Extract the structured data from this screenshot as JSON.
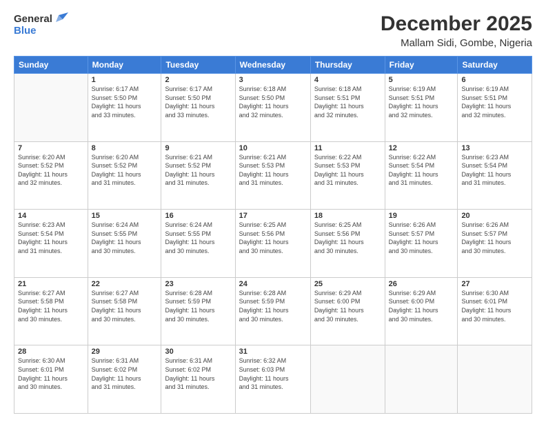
{
  "header": {
    "logo_general": "General",
    "logo_blue": "Blue",
    "month": "December 2025",
    "location": "Mallam Sidi, Gombe, Nigeria"
  },
  "days_of_week": [
    "Sunday",
    "Monday",
    "Tuesday",
    "Wednesday",
    "Thursday",
    "Friday",
    "Saturday"
  ],
  "weeks": [
    [
      {
        "day": "",
        "info": ""
      },
      {
        "day": "1",
        "info": "Sunrise: 6:17 AM\nSunset: 5:50 PM\nDaylight: 11 hours\nand 33 minutes."
      },
      {
        "day": "2",
        "info": "Sunrise: 6:17 AM\nSunset: 5:50 PM\nDaylight: 11 hours\nand 33 minutes."
      },
      {
        "day": "3",
        "info": "Sunrise: 6:18 AM\nSunset: 5:50 PM\nDaylight: 11 hours\nand 32 minutes."
      },
      {
        "day": "4",
        "info": "Sunrise: 6:18 AM\nSunset: 5:51 PM\nDaylight: 11 hours\nand 32 minutes."
      },
      {
        "day": "5",
        "info": "Sunrise: 6:19 AM\nSunset: 5:51 PM\nDaylight: 11 hours\nand 32 minutes."
      },
      {
        "day": "6",
        "info": "Sunrise: 6:19 AM\nSunset: 5:51 PM\nDaylight: 11 hours\nand 32 minutes."
      }
    ],
    [
      {
        "day": "7",
        "info": "Sunrise: 6:20 AM\nSunset: 5:52 PM\nDaylight: 11 hours\nand 32 minutes."
      },
      {
        "day": "8",
        "info": "Sunrise: 6:20 AM\nSunset: 5:52 PM\nDaylight: 11 hours\nand 31 minutes."
      },
      {
        "day": "9",
        "info": "Sunrise: 6:21 AM\nSunset: 5:52 PM\nDaylight: 11 hours\nand 31 minutes."
      },
      {
        "day": "10",
        "info": "Sunrise: 6:21 AM\nSunset: 5:53 PM\nDaylight: 11 hours\nand 31 minutes."
      },
      {
        "day": "11",
        "info": "Sunrise: 6:22 AM\nSunset: 5:53 PM\nDaylight: 11 hours\nand 31 minutes."
      },
      {
        "day": "12",
        "info": "Sunrise: 6:22 AM\nSunset: 5:54 PM\nDaylight: 11 hours\nand 31 minutes."
      },
      {
        "day": "13",
        "info": "Sunrise: 6:23 AM\nSunset: 5:54 PM\nDaylight: 11 hours\nand 31 minutes."
      }
    ],
    [
      {
        "day": "14",
        "info": "Sunrise: 6:23 AM\nSunset: 5:54 PM\nDaylight: 11 hours\nand 31 minutes."
      },
      {
        "day": "15",
        "info": "Sunrise: 6:24 AM\nSunset: 5:55 PM\nDaylight: 11 hours\nand 30 minutes."
      },
      {
        "day": "16",
        "info": "Sunrise: 6:24 AM\nSunset: 5:55 PM\nDaylight: 11 hours\nand 30 minutes."
      },
      {
        "day": "17",
        "info": "Sunrise: 6:25 AM\nSunset: 5:56 PM\nDaylight: 11 hours\nand 30 minutes."
      },
      {
        "day": "18",
        "info": "Sunrise: 6:25 AM\nSunset: 5:56 PM\nDaylight: 11 hours\nand 30 minutes."
      },
      {
        "day": "19",
        "info": "Sunrise: 6:26 AM\nSunset: 5:57 PM\nDaylight: 11 hours\nand 30 minutes."
      },
      {
        "day": "20",
        "info": "Sunrise: 6:26 AM\nSunset: 5:57 PM\nDaylight: 11 hours\nand 30 minutes."
      }
    ],
    [
      {
        "day": "21",
        "info": "Sunrise: 6:27 AM\nSunset: 5:58 PM\nDaylight: 11 hours\nand 30 minutes."
      },
      {
        "day": "22",
        "info": "Sunrise: 6:27 AM\nSunset: 5:58 PM\nDaylight: 11 hours\nand 30 minutes."
      },
      {
        "day": "23",
        "info": "Sunrise: 6:28 AM\nSunset: 5:59 PM\nDaylight: 11 hours\nand 30 minutes."
      },
      {
        "day": "24",
        "info": "Sunrise: 6:28 AM\nSunset: 5:59 PM\nDaylight: 11 hours\nand 30 minutes."
      },
      {
        "day": "25",
        "info": "Sunrise: 6:29 AM\nSunset: 6:00 PM\nDaylight: 11 hours\nand 30 minutes."
      },
      {
        "day": "26",
        "info": "Sunrise: 6:29 AM\nSunset: 6:00 PM\nDaylight: 11 hours\nand 30 minutes."
      },
      {
        "day": "27",
        "info": "Sunrise: 6:30 AM\nSunset: 6:01 PM\nDaylight: 11 hours\nand 30 minutes."
      }
    ],
    [
      {
        "day": "28",
        "info": "Sunrise: 6:30 AM\nSunset: 6:01 PM\nDaylight: 11 hours\nand 30 minutes."
      },
      {
        "day": "29",
        "info": "Sunrise: 6:31 AM\nSunset: 6:02 PM\nDaylight: 11 hours\nand 31 minutes."
      },
      {
        "day": "30",
        "info": "Sunrise: 6:31 AM\nSunset: 6:02 PM\nDaylight: 11 hours\nand 31 minutes."
      },
      {
        "day": "31",
        "info": "Sunrise: 6:32 AM\nSunset: 6:03 PM\nDaylight: 11 hours\nand 31 minutes."
      },
      {
        "day": "",
        "info": ""
      },
      {
        "day": "",
        "info": ""
      },
      {
        "day": "",
        "info": ""
      }
    ]
  ]
}
